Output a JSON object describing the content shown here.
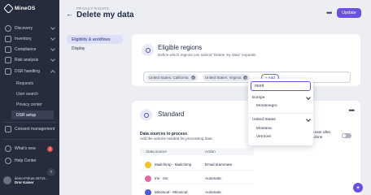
{
  "app": {
    "logo_text": "MineOS"
  },
  "sidebar": {
    "items": [
      {
        "label": "Discovery",
        "icon": "compass-icon"
      },
      {
        "label": "Inventory",
        "icon": "database-icon"
      },
      {
        "label": "Compliance",
        "icon": "shield-icon"
      },
      {
        "label": "Risk analysis",
        "icon": "chart-icon"
      },
      {
        "label": "DSR handling",
        "icon": "inbox-icon"
      }
    ],
    "sub_items": [
      "Requests",
      "User search",
      "Privacy center",
      "DSR setup"
    ],
    "consent": "Consent management",
    "whats_new": "What's new",
    "whats_new_count": "3",
    "help": "Help Center",
    "user": {
      "name": "demo-Pirkas-46715...",
      "sub": "Dror Kaiser"
    }
  },
  "header": {
    "breadcrumb": "PRIVACY RIGHTS",
    "title": "Delete my data",
    "more": "•••",
    "update_label": "Update"
  },
  "tabs": [
    "Eligibility & workflows",
    "Display"
  ],
  "eligible": {
    "title": "Eligible regions",
    "description": "Define which regions can submit \"Delete my data\" requests",
    "chips": [
      "United States: California",
      "United States: Virginia"
    ],
    "add_label": "+ Add"
  },
  "standard": {
    "title": "Standard",
    "more": "•••",
    "data_sources_title": "Data sources to process",
    "data_sources_sub": "Add the actions needed for processing data",
    "columns": [
      "Data source",
      "Action"
    ],
    "rows": [
      {
        "name": "Mailchimp - Mailchimp",
        "action": "Email teammate",
        "color": "#f2c230"
      },
      {
        "name": "Iris - Iris",
        "action": "Automatic",
        "color": "#e36aa3"
      },
      {
        "name": "Minoscal - Minoscal",
        "action": "Automatic",
        "color": "#4f5bd5"
      }
    ],
    "apply_label_1": "pply to user after",
    "apply_label_2": "ns are done",
    "toggle_on": false
  },
  "dropdown": {
    "search_value": "mont",
    "groups": [
      {
        "label": "Europe",
        "options": [
          "Montenegro"
        ]
      },
      {
        "label": "United States",
        "options": [
          "Montana",
          "Vermont"
        ]
      }
    ]
  },
  "colors": {
    "accent": "#6b50e0",
    "sidebar_bg": "#262c3b"
  }
}
